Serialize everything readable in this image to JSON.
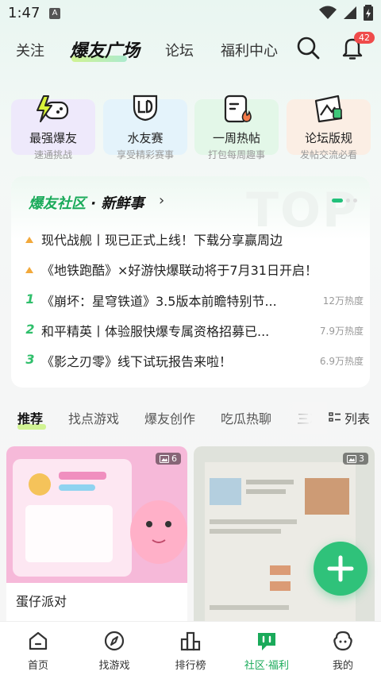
{
  "status_bar": {
    "time": "1:47",
    "app_indicator": "A"
  },
  "top_nav": {
    "tabs": [
      {
        "label": "关注"
      },
      {
        "label": "爆友广场"
      },
      {
        "label": "论坛"
      },
      {
        "label": "福利中心"
      }
    ],
    "active_tab": "爆友广场",
    "notification_count": "42"
  },
  "quick_entries": [
    {
      "title": "最强爆友",
      "subtitle": "速通挑战",
      "icon": "gamepad-lightning-icon",
      "bg": "#eee9fb"
    },
    {
      "title": "水友赛",
      "subtitle": "享受精彩赛事",
      "icon": "trophy-cup-icon",
      "bg": "#e4f3fb"
    },
    {
      "title": "一周热帖",
      "subtitle": "打包每周趣事",
      "icon": "hot-post-icon",
      "bg": "#e3f7e8"
    },
    {
      "title": "论坛版规",
      "subtitle": "发帖交流必看",
      "icon": "rules-board-icon",
      "bg": "#fbeee4"
    }
  ],
  "community": {
    "title_brand": "爆友社区",
    "title_suffix": "· 新鲜事",
    "watermark": "TOP",
    "items": [
      {
        "rank": "",
        "marker": "triangle",
        "text": "现代战舰丨现已正式上线！下载分享赢周边",
        "heat": ""
      },
      {
        "rank": "",
        "marker": "triangle",
        "text": "《地铁跑酷》×好游快爆联动将于7月31日开启！",
        "heat": ""
      },
      {
        "rank": "1",
        "marker": "number",
        "text": "《崩坏：星穹铁道》3.5版本前瞻特别节...",
        "heat": "12万热度"
      },
      {
        "rank": "2",
        "marker": "number",
        "text": "和平精英丨体验服快爆专属资格招募已...",
        "heat": "7.9万热度"
      },
      {
        "rank": "3",
        "marker": "number",
        "text": "《影之刃零》线下试玩报告来啦！",
        "heat": "6.9万热度"
      }
    ]
  },
  "feed_tabs": {
    "tabs": [
      "推荐",
      "找点游戏",
      "爆友创作",
      "吃瓜热聊",
      "三次"
    ],
    "active": "推荐",
    "list_label": "列表"
  },
  "feed_cards": [
    {
      "title": "蛋仔派对",
      "image_count": "6"
    },
    {
      "title": "",
      "image_count": "3"
    }
  ],
  "bottom_nav": {
    "items": [
      {
        "label": "首页",
        "icon": "home-icon"
      },
      {
        "label": "找游戏",
        "icon": "compass-icon"
      },
      {
        "label": "排行榜",
        "icon": "bar-chart-icon"
      },
      {
        "label": "社区·福利",
        "icon": "community-chat-icon"
      },
      {
        "label": "我的",
        "icon": "profile-face-icon"
      }
    ],
    "active": "社区·福利"
  },
  "colors": {
    "brand_green": "#1aaa5a",
    "fab_green": "#2fc27a",
    "badge_red": "#ef4b4b",
    "lime_accent": "#c8f27a"
  }
}
